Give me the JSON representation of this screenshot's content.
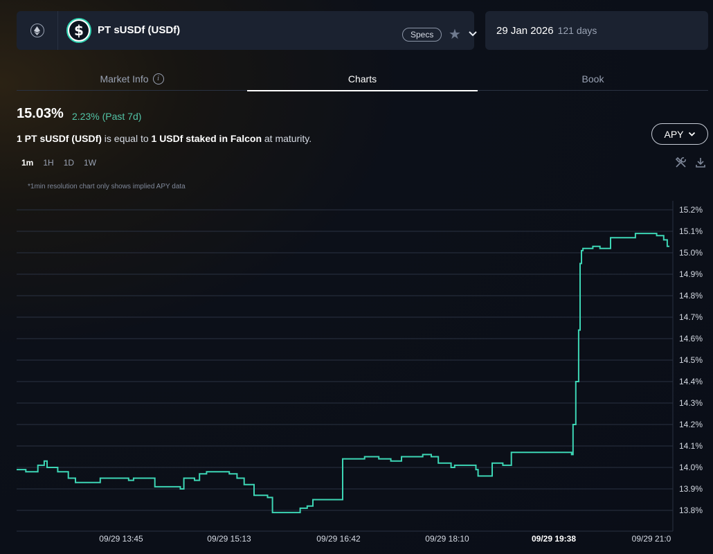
{
  "header": {
    "chain_icon": "ethereum-icon",
    "token_icon": "dollar-coin-icon",
    "market_name": "PT sUSDf (USDf)",
    "specs_label": "Specs",
    "maturity_date": "29 Jan 2026",
    "days_left": "121 days"
  },
  "tabs": [
    {
      "label": "Market Info"
    },
    {
      "label": "Charts"
    },
    {
      "label": "Book"
    }
  ],
  "summary": {
    "current_apy": "15.03%",
    "change": "2.23% (Past 7d)",
    "desc_part1": "1 PT sUSDf (USDf)",
    "desc_part2": " is equal to ",
    "desc_part3": "1 USDf staked in Falcon",
    "desc_part4": " at maturity.",
    "metric_label": "APY"
  },
  "timeframes": [
    "1m",
    "1H",
    "1D",
    "1W"
  ],
  "note": "*1min resolution chart only shows implied APY data",
  "colors": {
    "line": "#3dd6b5",
    "accent": "#53c4a7",
    "grid": "#2a3242"
  },
  "chart_data": {
    "type": "line",
    "series_step": true,
    "y_ticks": [
      "13.8%",
      "13.9%",
      "14.0%",
      "14.1%",
      "14.2%",
      "14.3%",
      "14.4%",
      "14.5%",
      "14.6%",
      "14.7%",
      "14.8%",
      "14.9%",
      "15.0%",
      "15.1%",
      "15.2%"
    ],
    "x_ticks": [
      "09/29 13:45",
      "09/29 15:13",
      "09/29 16:42",
      "09/29 18:10",
      "09/29 19:38",
      "09/29 21:0"
    ],
    "x_tick_bold": [
      false,
      false,
      false,
      false,
      true,
      false
    ],
    "ylim": [
      13.75,
      15.25
    ],
    "x_minutes_range": [
      12.87,
      21.5
    ],
    "x_tick_minutes": [
      13.75,
      15.217,
      16.7,
      18.167,
      19.633,
      21.0
    ],
    "points": [
      [
        12.87,
        13.99
      ],
      [
        13.0,
        13.98
      ],
      [
        13.17,
        14.01
      ],
      [
        13.26,
        14.03
      ],
      [
        13.3,
        14.0
      ],
      [
        13.45,
        13.98
      ],
      [
        13.6,
        13.95
      ],
      [
        13.7,
        13.93
      ],
      [
        13.95,
        13.93
      ],
      [
        14.05,
        13.95
      ],
      [
        14.35,
        13.95
      ],
      [
        14.45,
        13.94
      ],
      [
        14.52,
        13.95
      ],
      [
        14.82,
        13.91
      ],
      [
        15.18,
        13.9
      ],
      [
        15.23,
        13.95
      ],
      [
        15.38,
        13.94
      ],
      [
        15.45,
        13.97
      ],
      [
        15.55,
        13.98
      ],
      [
        15.72,
        13.98
      ],
      [
        15.87,
        13.97
      ],
      [
        15.98,
        13.95
      ],
      [
        16.08,
        13.92
      ],
      [
        16.22,
        13.87
      ],
      [
        16.41,
        13.86
      ],
      [
        16.48,
        13.79
      ],
      [
        16.65,
        13.79
      ],
      [
        16.87,
        13.81
      ],
      [
        16.97,
        13.82
      ],
      [
        17.05,
        13.85
      ],
      [
        17.11,
        13.85
      ],
      [
        17.45,
        13.85
      ],
      [
        17.47,
        14.04
      ],
      [
        17.78,
        14.05
      ],
      [
        17.9,
        14.05
      ],
      [
        17.98,
        14.04
      ],
      [
        18.08,
        14.04
      ],
      [
        18.15,
        14.03
      ],
      [
        18.3,
        14.05
      ],
      [
        18.6,
        14.06
      ],
      [
        18.72,
        14.05
      ],
      [
        18.82,
        14.02
      ],
      [
        18.9,
        14.02
      ],
      [
        19.0,
        14.0
      ],
      [
        19.05,
        14.01
      ],
      [
        19.2,
        14.01
      ],
      [
        19.35,
        13.99
      ],
      [
        19.38,
        13.96
      ],
      [
        19.52,
        13.96
      ],
      [
        19.58,
        14.02
      ],
      [
        19.73,
        14.01
      ],
      [
        19.85,
        14.07
      ],
      [
        20.55,
        14.07
      ],
      [
        20.7,
        14.06
      ],
      [
        20.72,
        14.2
      ],
      [
        20.76,
        14.4
      ],
      [
        20.8,
        14.64
      ],
      [
        20.82,
        14.95
      ],
      [
        20.84,
        15.01
      ],
      [
        20.86,
        15.02
      ],
      [
        21.0,
        15.03
      ],
      [
        21.1,
        15.02
      ],
      [
        21.25,
        15.07
      ],
      [
        21.48,
        15.07
      ],
      [
        21.6,
        15.09
      ],
      [
        21.83,
        15.09
      ],
      [
        21.9,
        15.08
      ],
      [
        22.0,
        15.06
      ],
      [
        22.05,
        15.03
      ],
      [
        22.08,
        15.03
      ]
    ]
  }
}
